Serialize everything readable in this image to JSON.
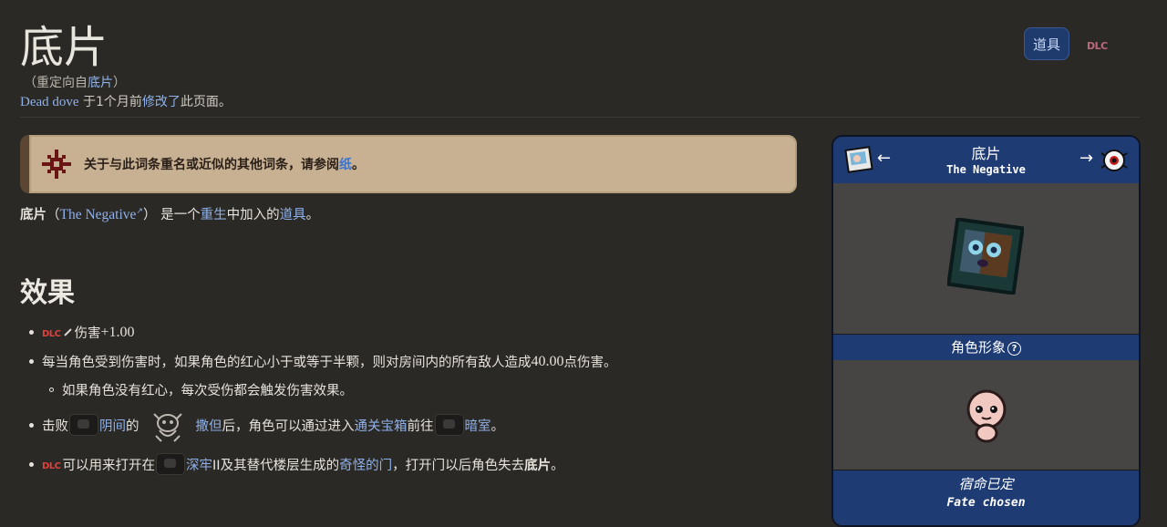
{
  "header": {
    "title": "底片",
    "redirect_prefix": "（重定向自",
    "redirect_link": "底片",
    "redirect_suffix": "）",
    "editor": "Dead dove",
    "edit_middle": " 于1个月前",
    "edit_link": "修改了",
    "edit_suffix": "此页面。"
  },
  "top_tabs": {
    "item_label": "道具",
    "dlc_label": "DLC"
  },
  "hatnote": {
    "text": "关于与此词条重名或近似的其他词条，请参阅",
    "link": "纸",
    "suffix": "。"
  },
  "intro": {
    "name": "底片",
    "open_paren": "（",
    "english_name": "The Negative",
    "close_paren": "）",
    "middle": "是一个",
    "dlc_link": "重生",
    "middle2": "中加入的",
    "type_link": "道具",
    "end": "。"
  },
  "effects": {
    "heading": "效果",
    "item1": {
      "dlc": "DLC",
      "text": "伤害 ",
      "value": "+1.00"
    },
    "item2": {
      "pre": "每当角色受到伤害时，如果角色的红心小于或等于半颗，则对房间内的所有敌人造成 ",
      "value": "40.00",
      "post": " 点伤害。"
    },
    "item2_sub": "如果角色没有红心，每次受伤都会触发伤害效果。",
    "item3": {
      "pre": "击败",
      "link1": "阴间",
      "mid1": "的",
      "link2": "撒但",
      "mid2": "后，角色可以通过进入",
      "link3": "通关宝箱",
      "mid3": "前往",
      "link4": "暗室",
      "end": "。"
    },
    "item4": {
      "dlc": "DLC",
      "pre": "可以用来打开在",
      "link1": "深牢",
      "mid1": "II及其替代楼层生成的",
      "link2": "奇怪的门",
      "mid2": "，打开门以后角色失去",
      "bold": "底片",
      "end": "。"
    }
  },
  "infobox": {
    "title": "底片",
    "subtitle": "The Negative",
    "prev_arrow": "←",
    "next_arrow": "→",
    "character_label": "角色形象",
    "help_icon": "?",
    "fate_cn": "宿命已定",
    "fate_en": "Fate chosen",
    "colors": {
      "header": "#1e3b73",
      "panel": "#474544"
    }
  }
}
